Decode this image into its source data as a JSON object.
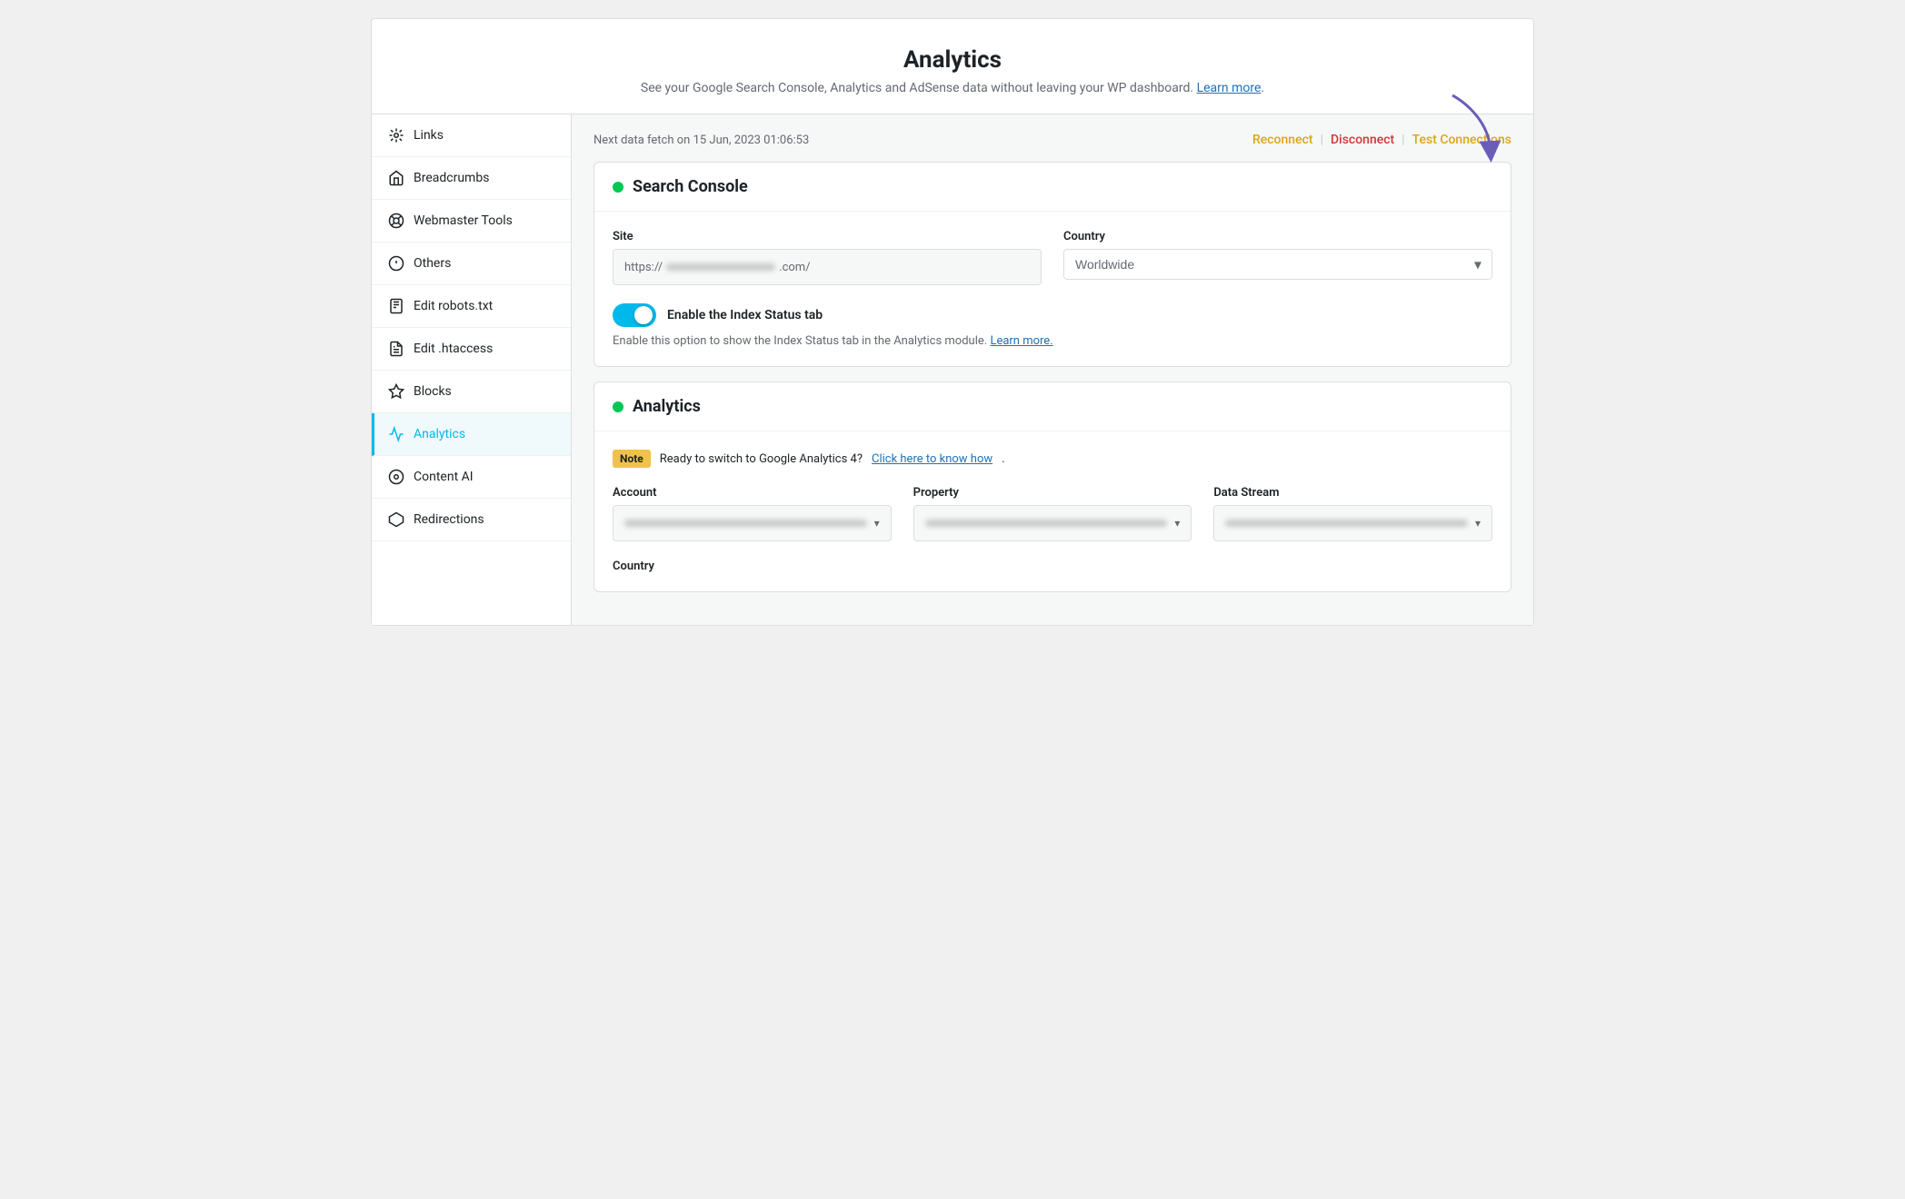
{
  "page": {
    "title": "Analytics",
    "subtitle": "See your Google Search Console, Analytics and AdSense data without leaving your WP dashboard.",
    "learn_more_link": "Learn more",
    "next_fetch": "Next data fetch on 15 Jun, 2023 01:06:53"
  },
  "top_actions": {
    "reconnect": "Reconnect",
    "disconnect": "Disconnect",
    "test_connections": "Test Connections"
  },
  "sidebar": {
    "items": [
      {
        "id": "links",
        "label": "Links",
        "icon": "✦"
      },
      {
        "id": "breadcrumbs",
        "label": "Breadcrumbs",
        "icon": "⊥"
      },
      {
        "id": "webmaster-tools",
        "label": "Webmaster Tools",
        "icon": "⊙"
      },
      {
        "id": "others",
        "label": "Others",
        "icon": "⊕"
      },
      {
        "id": "edit-robots",
        "label": "Edit robots.txt",
        "icon": "☐"
      },
      {
        "id": "edit-htaccess",
        "label": "Edit .htaccess",
        "icon": "☰"
      },
      {
        "id": "blocks",
        "label": "Blocks",
        "icon": "❋"
      },
      {
        "id": "analytics",
        "label": "Analytics",
        "icon": "⋯"
      },
      {
        "id": "content-ai",
        "label": "Content AI",
        "icon": "◎"
      },
      {
        "id": "redirections",
        "label": "Redirections",
        "icon": "◇"
      }
    ]
  },
  "search_console": {
    "title": "Search Console",
    "site_label": "Site",
    "site_placeholder": "https://               .com/",
    "country_label": "Country",
    "country_value": "Worldwide",
    "toggle_label": "Enable the Index Status tab",
    "toggle_desc": "Enable this option to show the Index Status tab in the Analytics module.",
    "toggle_learn_more": "Learn more."
  },
  "analytics_section": {
    "title": "Analytics",
    "note_badge": "Note",
    "note_text": "Ready to switch to Google Analytics 4?",
    "note_link": "Click here to know how",
    "account_label": "Account",
    "property_label": "Property",
    "data_stream_label": "Data Stream",
    "country_label": "Country"
  },
  "colors": {
    "active_sidebar": "#00b9eb",
    "reconnect": "#dba617",
    "disconnect": "#d63638",
    "test_connections": "#dba617",
    "dot_green": "#00c853",
    "note_badge_bg": "#f0c14b",
    "toggle_on": "#00b9eb"
  }
}
